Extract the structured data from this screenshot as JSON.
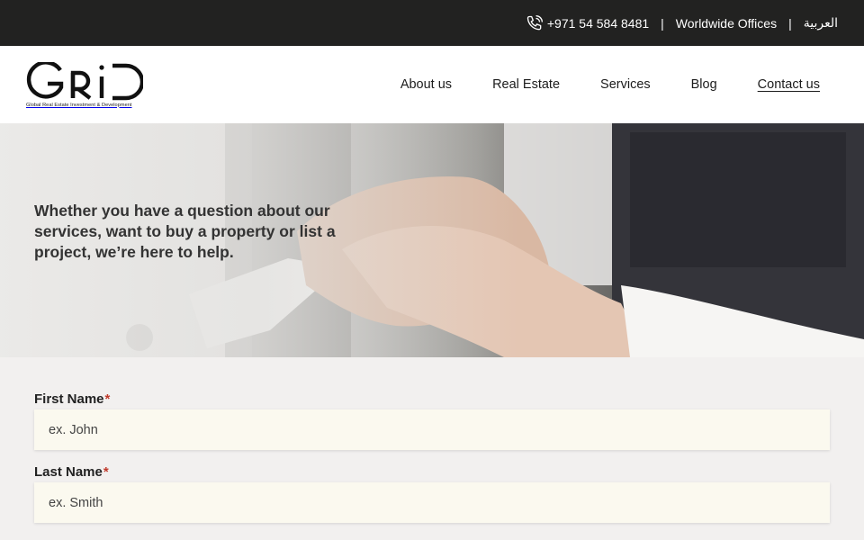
{
  "topbar": {
    "phone_icon": "phone-icon",
    "phone": "+971 54 584 8481",
    "separator": "|",
    "worldwide": "Worldwide Offices",
    "language": "العربية"
  },
  "logo": {
    "wordmark": "GRID",
    "tagline": "Global Real Estate Investment & Development"
  },
  "nav": {
    "items": [
      "About us",
      "Real Estate",
      "Services",
      "Blog",
      "Contact us"
    ],
    "active": "Contact us"
  },
  "hero": {
    "heading": "Whether you have a question about our services, want to buy a property or list a project, we’re here to help."
  },
  "form": {
    "first_name": {
      "label": "First Name",
      "required_mark": "*",
      "placeholder": "ex. John",
      "value": ""
    },
    "last_name": {
      "label": "Last Name",
      "required_mark": "*",
      "placeholder": "ex. Smith",
      "value": ""
    }
  },
  "colors": {
    "topbar": "#222221",
    "required": "#c0392b",
    "input_bg": "#fbf9ef"
  }
}
